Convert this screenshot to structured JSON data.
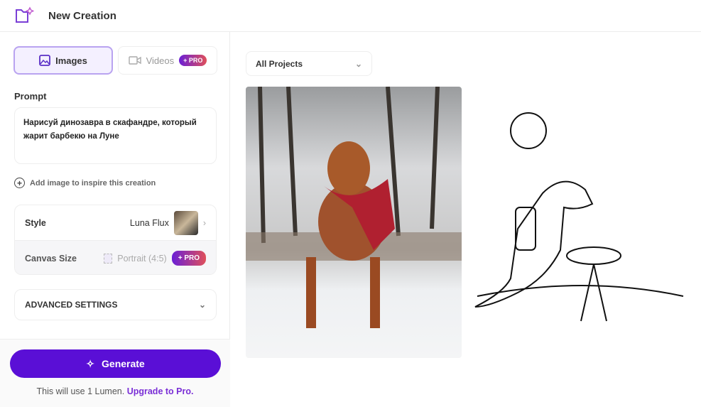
{
  "header": {
    "title": "New Creation",
    "icon": "folder-sparkle-icon"
  },
  "tabs": [
    {
      "label": "Images",
      "icon": "image-icon",
      "active": true
    },
    {
      "label": "Videos",
      "icon": "video-icon",
      "badge": "+ PRO"
    }
  ],
  "prompt": {
    "label": "Prompt",
    "value": "Нарисуй динозавра в скафандре, который жарит барбекю на Луне"
  },
  "add_image": "Add image to inspire this creation",
  "settings": {
    "style_label": "Style",
    "style_value": "Luna Flux",
    "canvas_label": "Canvas Size",
    "canvas_value": "Portrait (4:5)",
    "canvas_badge": "+ PRO"
  },
  "advanced": "ADVANCED SETTINGS",
  "generate": "Generate",
  "note": {
    "text": "This will use 1 Lumen.",
    "link": "Upgrade to Pro."
  },
  "projects": {
    "selected": "All Projects"
  },
  "colors": {
    "accent": "#5a0fd6",
    "link": "#7a2fd6"
  }
}
